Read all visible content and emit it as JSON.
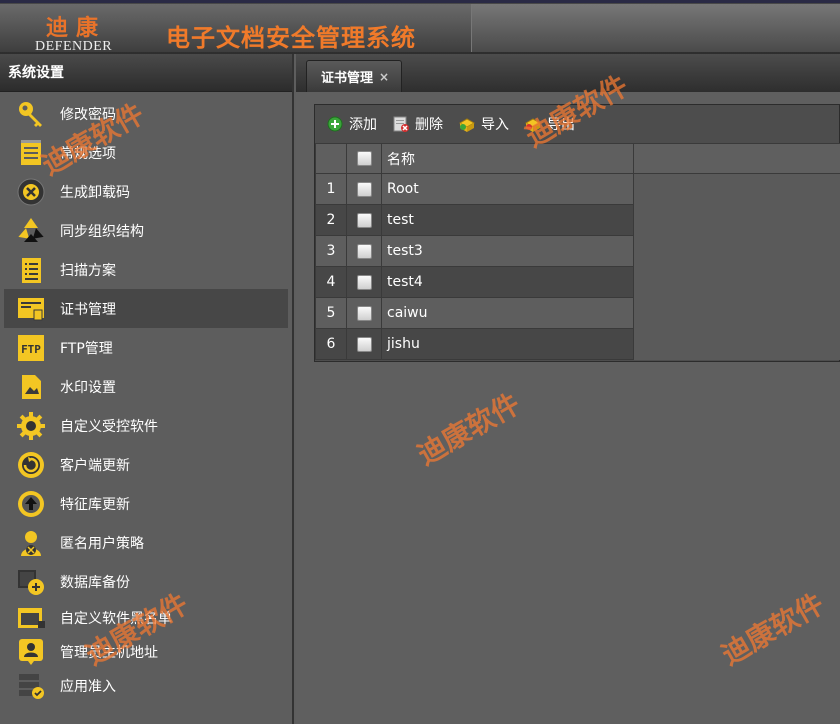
{
  "header": {
    "logo_cn": "迪康",
    "logo_en": "DEFENDER",
    "title": "电子文档安全管理系统"
  },
  "sidebar": {
    "title": "系统设置",
    "items": [
      {
        "label": "修改密码",
        "icon": "key-icon"
      },
      {
        "label": "常规选项",
        "icon": "notepad-icon"
      },
      {
        "label": "生成卸载码",
        "icon": "uninstall-x-icon"
      },
      {
        "label": "同步组织结构",
        "icon": "sync-recycle-icon"
      },
      {
        "label": "扫描方案",
        "icon": "scan-doc-icon"
      },
      {
        "label": "证书管理",
        "icon": "certificate-icon",
        "active": true
      },
      {
        "label": "FTP管理",
        "icon": "ftp-icon"
      },
      {
        "label": "水印设置",
        "icon": "watermark-doc-icon"
      },
      {
        "label": "自定义受控软件",
        "icon": "gear-icon"
      },
      {
        "label": "客户端更新",
        "icon": "refresh-circle-icon"
      },
      {
        "label": "特征库更新",
        "icon": "upload-circle-icon"
      },
      {
        "label": "匿名用户策略",
        "icon": "anonymous-user-icon"
      },
      {
        "label": "数据库备份",
        "icon": "database-add-icon"
      },
      {
        "label": "自定义软件黑名单",
        "icon": "blacklist-window-icon"
      },
      {
        "label": "管理员主机地址",
        "icon": "admin-host-icon"
      },
      {
        "label": "应用准入",
        "icon": "app-access-icon"
      }
    ]
  },
  "tab": {
    "label": "证书管理",
    "close": "×"
  },
  "toolbar": {
    "add": "添加",
    "delete": "删除",
    "import": "导入",
    "export": "导出"
  },
  "table": {
    "header_name": "名称",
    "rows": [
      {
        "num": "1",
        "name": "Root"
      },
      {
        "num": "2",
        "name": "test"
      },
      {
        "num": "3",
        "name": "test3"
      },
      {
        "num": "4",
        "name": "test4"
      },
      {
        "num": "5",
        "name": "caiwu"
      },
      {
        "num": "6",
        "name": "jishu"
      }
    ]
  },
  "watermark": "迪康软件",
  "colors": {
    "accent": "#f07a2a",
    "icon_yellow": "#f3c623"
  }
}
